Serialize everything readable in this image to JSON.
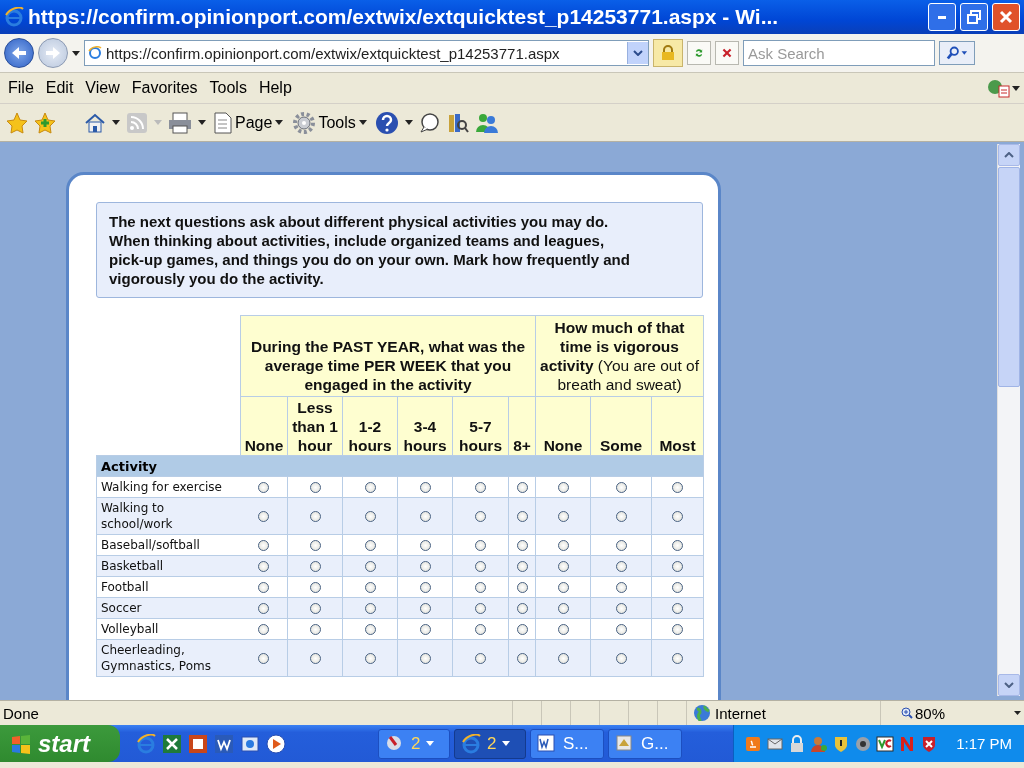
{
  "window": {
    "title": "https://confirm.opinionport.com/extwix/extquicktest_p14253771.aspx - Wi..."
  },
  "address_bar": {
    "url": "https://confirm.opinionport.com/extwix/extquicktest_p14253771.aspx",
    "search_placeholder": "Ask Search"
  },
  "menu": [
    "File",
    "Edit",
    "View",
    "Favorites",
    "Tools",
    "Help"
  ],
  "toolbar": [
    "Page",
    "Tools"
  ],
  "survey": {
    "intro": "The next questions ask about different physical activities you may do. When thinking about activities, include organized teams and leagues, pick-up games, and things you do on your own. Mark how frequently and vigorously you do the activity.",
    "group_headers": [
      {
        "text": "During the PAST YEAR, what was the average time PER WEEK that you engaged in the activity"
      },
      {
        "text": "**How much of that time is vigorous activity** (You are out of breath and sweat)"
      }
    ],
    "columns": [
      "None",
      "Less than 1 hour",
      "1-2 hours",
      "3-4 hours",
      "5-7 hours",
      "8+",
      "None",
      "Some",
      "Most"
    ],
    "section_label": "Activity",
    "rows": [
      {
        "label": "Walking for exercise",
        "options": [
          {
            "selected": false
          },
          {
            "selected": false
          },
          {
            "selected": false
          },
          {
            "selected": false
          },
          {
            "selected": false
          },
          {
            "selected": false
          },
          {
            "selected": false
          },
          {
            "selected": false
          },
          {
            "selected": false
          }
        ]
      },
      {
        "label": "Walking to school/work",
        "options": [
          {
            "selected": false
          },
          {
            "selected": false
          },
          {
            "selected": false
          },
          {
            "selected": false
          },
          {
            "selected": false
          },
          {
            "selected": false
          },
          {
            "selected": false
          },
          {
            "selected": false
          },
          {
            "selected": false
          }
        ]
      },
      {
        "label": "Baseball/softball",
        "options": [
          {
            "selected": false
          },
          {
            "selected": false
          },
          {
            "selected": false
          },
          {
            "selected": false
          },
          {
            "selected": false
          },
          {
            "selected": false
          },
          {
            "selected": false
          },
          {
            "selected": false
          },
          {
            "selected": false
          }
        ]
      },
      {
        "label": "Basketball",
        "options": [
          {
            "selected": false
          },
          {
            "selected": false
          },
          {
            "selected": false
          },
          {
            "selected": false
          },
          {
            "selected": false
          },
          {
            "selected": false
          },
          {
            "selected": false
          },
          {
            "selected": false
          },
          {
            "selected": false
          }
        ]
      },
      {
        "label": "Football",
        "options": [
          {
            "selected": false
          },
          {
            "selected": false
          },
          {
            "selected": false
          },
          {
            "selected": false
          },
          {
            "selected": false
          },
          {
            "selected": false
          },
          {
            "selected": false
          },
          {
            "selected": false
          },
          {
            "selected": false
          }
        ]
      },
      {
        "label": "Soccer",
        "options": [
          {
            "selected": false
          },
          {
            "selected": false
          },
          {
            "selected": false
          },
          {
            "selected": false
          },
          {
            "selected": false
          },
          {
            "selected": false
          },
          {
            "selected": false
          },
          {
            "selected": false
          },
          {
            "selected": false
          }
        ]
      },
      {
        "label": "Volleyball",
        "options": [
          {
            "selected": false
          },
          {
            "selected": false
          },
          {
            "selected": false
          },
          {
            "selected": false
          },
          {
            "selected": false
          },
          {
            "selected": false
          },
          {
            "selected": false
          },
          {
            "selected": false
          },
          {
            "selected": false
          }
        ]
      },
      {
        "label": "Cheerleading, Gymnastics, Poms",
        "options": [
          {
            "selected": false
          },
          {
            "selected": false
          },
          {
            "selected": false
          },
          {
            "selected": false
          },
          {
            "selected": false
          },
          {
            "selected": false
          },
          {
            "selected": false
          },
          {
            "selected": false
          },
          {
            "selected": false
          }
        ]
      }
    ]
  },
  "status_bar": {
    "text": "Done",
    "zone": "Internet",
    "zoom": "80%"
  },
  "taskbar": {
    "start": "start",
    "tasks": [
      {
        "label": "2",
        "kind": "group",
        "selected": false
      },
      {
        "label": "2",
        "kind": "group",
        "selected": true
      },
      {
        "label": "S...",
        "kind": "window",
        "selected": false
      },
      {
        "label": "G...",
        "kind": "window",
        "selected": false
      }
    ],
    "clock": "1:17 PM"
  }
}
